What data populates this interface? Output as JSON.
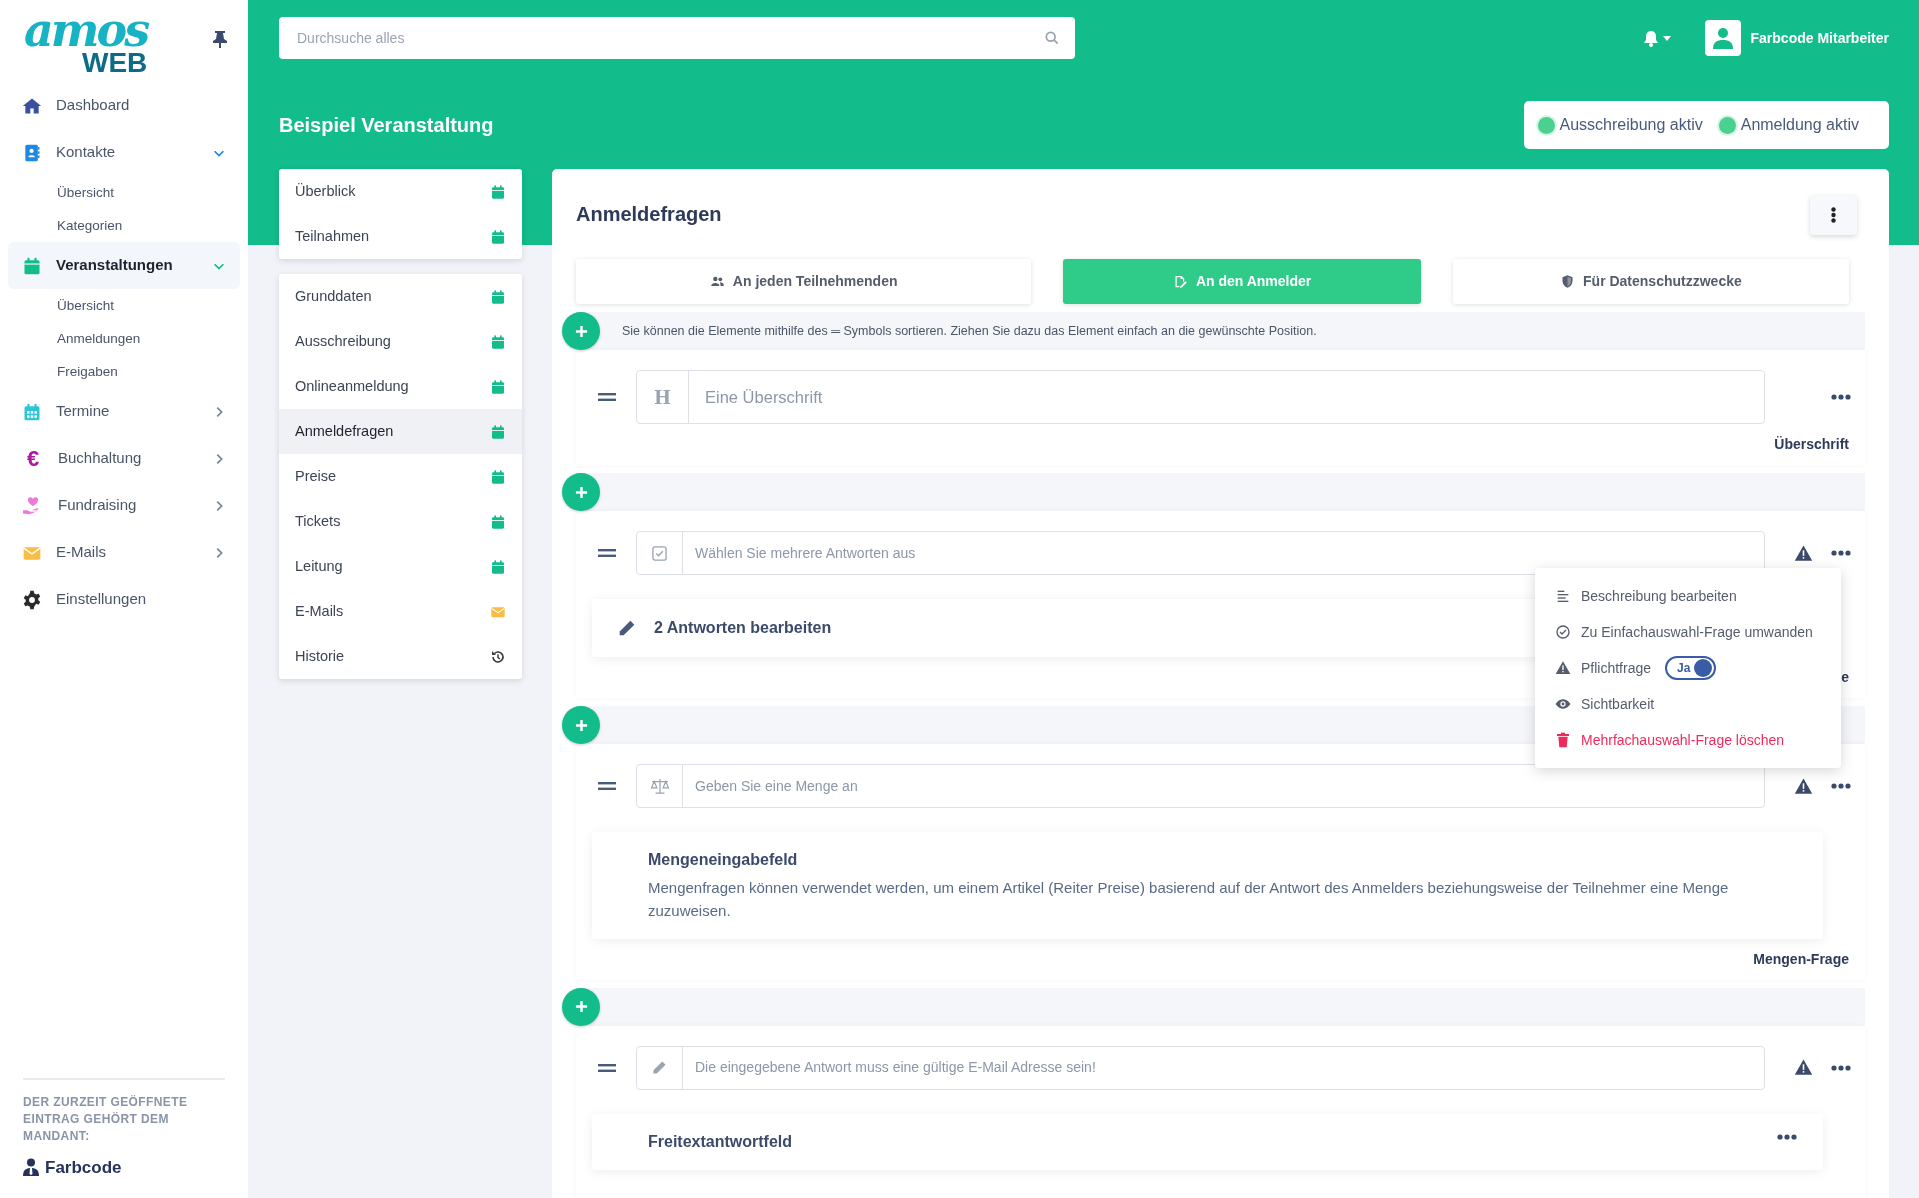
{
  "logo": {
    "script": "amos",
    "word": "WEB"
  },
  "sidebar": {
    "items": [
      {
        "label": "Dashboard",
        "color": "#3a4fa0",
        "selected": false
      },
      {
        "label": "Kontakte",
        "color": "#1e88e5",
        "selected": false,
        "expanded": true,
        "children": [
          {
            "label": "Übersicht"
          },
          {
            "label": "Kategorien"
          }
        ]
      },
      {
        "label": "Veranstaltungen",
        "color": "#12bc8b",
        "selected": true,
        "expanded": true,
        "children": [
          {
            "label": "Übersicht"
          },
          {
            "label": "Anmeldungen"
          },
          {
            "label": "Freigaben"
          }
        ]
      },
      {
        "label": "Termine",
        "color": "#2fc4d8",
        "selected": false,
        "expanded": false
      },
      {
        "label": "Buchhaltung",
        "glyph": "€",
        "color": "#b0179f",
        "selected": false,
        "expanded": false
      },
      {
        "label": "Fundraising",
        "color": "#ee7ad6",
        "selected": false,
        "expanded": false
      },
      {
        "label": "E-Mails",
        "color": "#f9bd43",
        "selected": false,
        "expanded": false
      },
      {
        "label": "Einstellungen",
        "color": "#2b2b2b",
        "selected": false
      }
    ],
    "footer": {
      "note": "DER ZURZEIT GEÖFFNETE EINTRAG GEHÖRT DEM MANDANT:",
      "tenant": "Farbcode"
    }
  },
  "topbar": {
    "search": {
      "placeholder": "Durchsuche alles"
    },
    "user": "Farbcode Mitarbeiter"
  },
  "page": {
    "title": "Beispiel Veranstaltung",
    "statuses": [
      {
        "label": "Ausschreibung aktiv",
        "active": true
      },
      {
        "label": "Anmeldung aktiv",
        "active": true
      }
    ]
  },
  "subnav": [
    [
      {
        "label": "Überblick",
        "selected": false
      },
      {
        "label": "Teilnahmen",
        "selected": false
      }
    ],
    [
      {
        "label": "Grunddaten",
        "selected": false
      },
      {
        "label": "Ausschreibung",
        "selected": false
      },
      {
        "label": "Onlineanmeldung",
        "selected": false
      },
      {
        "label": "Anmeldefragen",
        "selected": true
      },
      {
        "label": "Preise",
        "selected": false
      },
      {
        "label": "Tickets",
        "selected": false
      },
      {
        "label": "Leitung",
        "selected": false
      },
      {
        "label": "E-Mails",
        "selected": false
      },
      {
        "label": "Historie",
        "selected": false
      }
    ]
  ],
  "panel": {
    "title": "Anmeldefragen",
    "tabs": [
      {
        "label": "An jeden Teilnehmenden",
        "selected": false
      },
      {
        "label": "An den Anmelder",
        "selected": true
      },
      {
        "label": "Für Datenschutzzwecke",
        "selected": false
      }
    ],
    "hint": "Sie können die Elemente mithilfe des ═ Symbols sortieren. Ziehen Sie dazu das Element einfach an die gewünschte Position.",
    "questions": [
      {
        "kind": "heading",
        "glyph": "H",
        "placeholder": "Eine Überschrift",
        "required": false,
        "type_label": "Überschrift"
      },
      {
        "kind": "multi",
        "placeholder": "Wählen Sie mehrere Antworten aus",
        "required": true,
        "answers": "2 Antworten bearbeiten",
        "type_label": "e",
        "menu": [
          {
            "kind": "description",
            "label": "Beschreibung bearbeiten"
          },
          {
            "kind": "convert",
            "label": "Zu Einfachauswahl-Frage umwanden"
          },
          {
            "kind": "toggle",
            "label": "Pflichtfrage",
            "toggle_text": "Ja",
            "on": true
          },
          {
            "kind": "visibility",
            "label": "Sichtbarkeit"
          },
          {
            "kind": "delete",
            "label": "Mehrfachauswahl-Frage löschen"
          }
        ]
      },
      {
        "kind": "quantity",
        "placeholder": "Geben Sie eine Menge an",
        "required": true,
        "info_title": "Mengeneingabefeld",
        "info_text": "Mengenfragen können verwendet werden, um einem Artikel (Reiter Preise) basierend auf der Antwort des Anmelders beziehungsweise der Teilnehmer eine Menge zuzuweisen.",
        "type_label": "Mengen-Frage"
      },
      {
        "kind": "text",
        "placeholder": "Die eingegebene Antwort muss eine gültige E-Mail Adresse sein!",
        "required": true,
        "info_title": "Freitextantwortfeld"
      }
    ]
  }
}
